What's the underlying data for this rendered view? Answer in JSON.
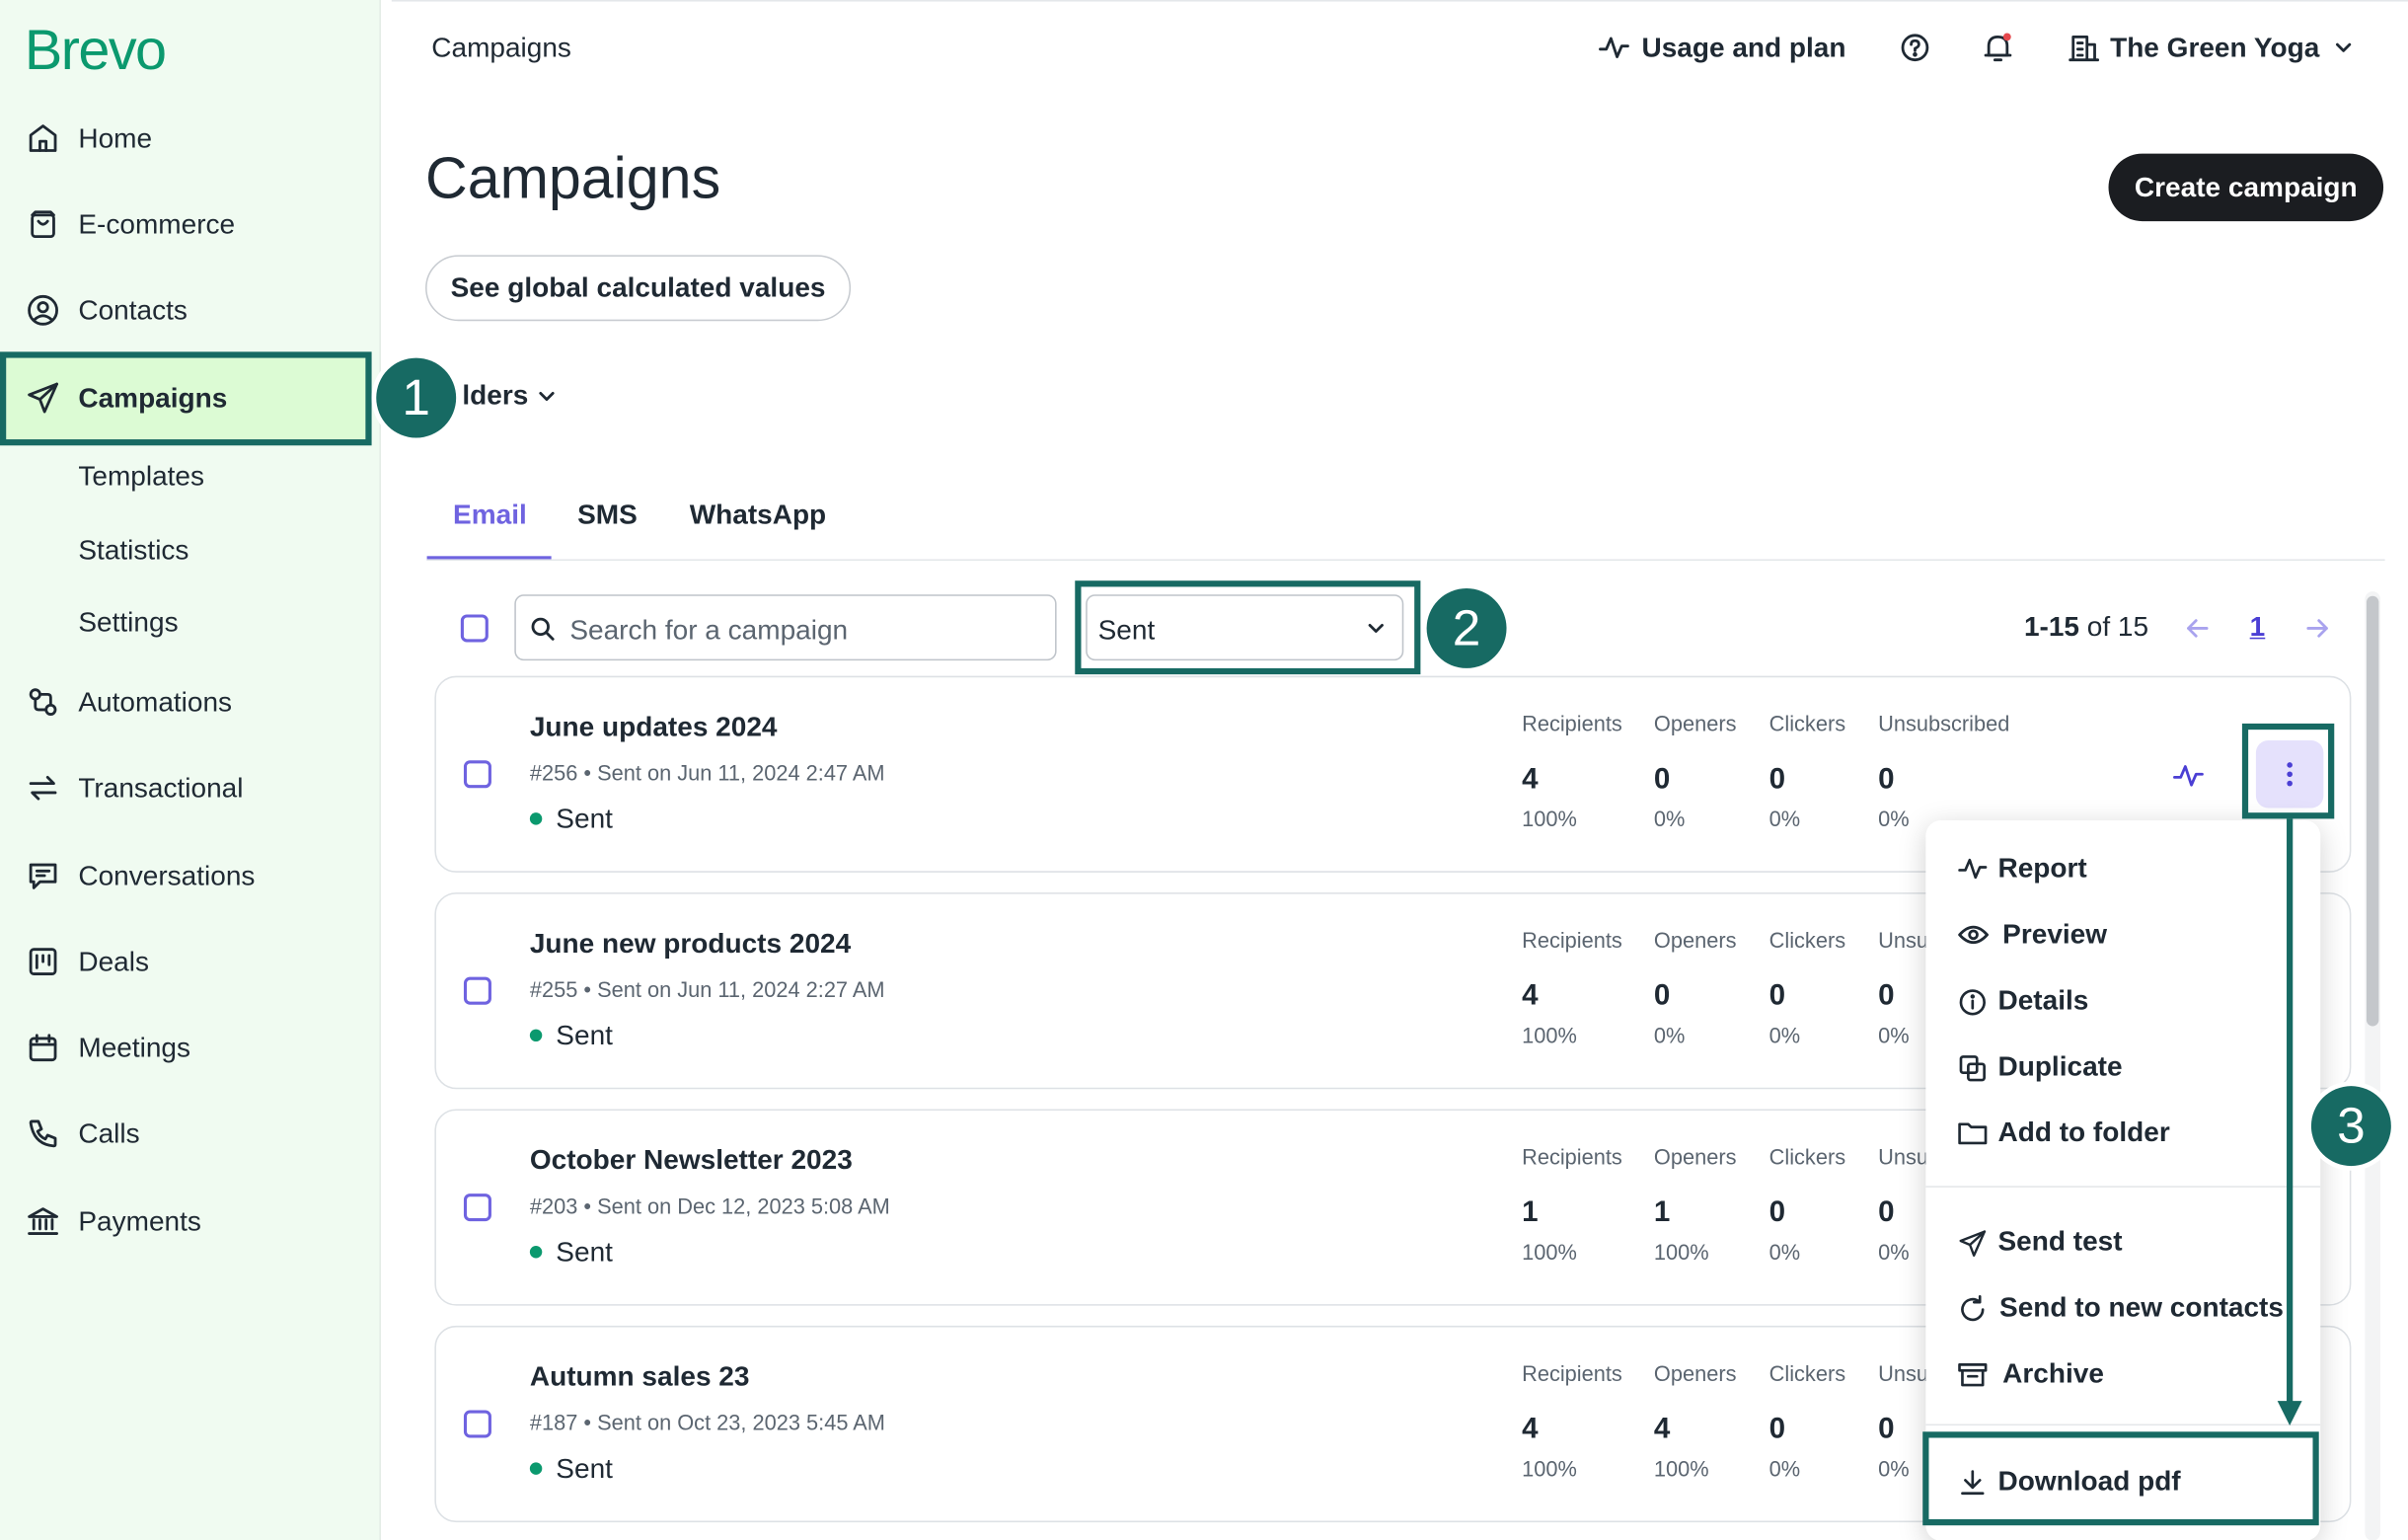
{
  "app": {
    "logo": "Brevo"
  },
  "sidebar": {
    "items": [
      {
        "label": "Home",
        "icon": "home-icon"
      },
      {
        "label": "E-commerce",
        "icon": "shopping-bag-icon"
      },
      {
        "label": "Contacts",
        "icon": "user-circle-icon"
      },
      {
        "label": "Campaigns",
        "icon": "send-icon"
      },
      {
        "label": "Automations",
        "icon": "automation-icon"
      },
      {
        "label": "Transactional",
        "icon": "arrows-swap-icon"
      },
      {
        "label": "Conversations",
        "icon": "chat-icon"
      },
      {
        "label": "Deals",
        "icon": "kanban-icon"
      },
      {
        "label": "Meetings",
        "icon": "calendar-icon"
      },
      {
        "label": "Calls",
        "icon": "phone-icon"
      },
      {
        "label": "Payments",
        "icon": "bank-icon"
      }
    ],
    "subitems": [
      "Templates",
      "Statistics",
      "Settings"
    ]
  },
  "topbar": {
    "title": "Campaigns",
    "usage": "Usage and plan",
    "account": "The Green Yoga"
  },
  "page": {
    "title": "Campaigns",
    "create_button": "Create campaign",
    "global_button": "See global calculated values",
    "folders": "lders"
  },
  "tabs": [
    "Email",
    "SMS",
    "WhatsApp"
  ],
  "filters": {
    "search_placeholder": "Search for a campaign",
    "status": "Sent",
    "range": "1-15",
    "total": "of 15",
    "page": "1"
  },
  "stat_labels": {
    "recipients": "Recipients",
    "openers": "Openers",
    "clickers": "Clickers",
    "unsubscribed": "Unsubscribed",
    "unsub_short": "Unsu"
  },
  "campaigns": [
    {
      "name": "June updates 2024",
      "id": "#256",
      "sent_on": "Sent on Jun 11, 2024 2:47 AM",
      "status": "Sent",
      "recipients": "4",
      "recipients_pct": "100%",
      "openers": "0",
      "openers_pct": "0%",
      "clickers": "0",
      "clickers_pct": "0%",
      "unsub": "0",
      "unsub_pct": "0%"
    },
    {
      "name": "June new products 2024",
      "id": "#255",
      "sent_on": "Sent on Jun 11, 2024 2:27 AM",
      "status": "Sent",
      "recipients": "4",
      "recipients_pct": "100%",
      "openers": "0",
      "openers_pct": "0%",
      "clickers": "0",
      "clickers_pct": "0%",
      "unsub": "0",
      "unsub_pct": "0%"
    },
    {
      "name": "October Newsletter 2023",
      "id": "#203",
      "sent_on": "Sent on Dec 12, 2023 5:08 AM",
      "status": "Sent",
      "recipients": "1",
      "recipients_pct": "100%",
      "openers": "1",
      "openers_pct": "100%",
      "clickers": "0",
      "clickers_pct": "0%",
      "unsub": "0",
      "unsub_pct": "0%"
    },
    {
      "name": "Autumn sales 23",
      "id": "#187",
      "sent_on": "Sent on Oct 23, 2023 5:45 AM",
      "status": "Sent",
      "recipients": "4",
      "recipients_pct": "100%",
      "openers": "4",
      "openers_pct": "100%",
      "clickers": "0",
      "clickers_pct": "0%",
      "unsub": "0",
      "unsub_pct": "0%"
    }
  ],
  "menu": {
    "items": [
      {
        "label": "Report",
        "icon": "activity-icon"
      },
      {
        "label": "Preview",
        "icon": "eye-icon"
      },
      {
        "label": "Details",
        "icon": "info-icon"
      },
      {
        "label": "Duplicate",
        "icon": "duplicate-icon"
      },
      {
        "label": "Add to folder",
        "icon": "folder-icon"
      },
      {
        "label": "Send test",
        "icon": "send-icon"
      },
      {
        "label": "Send to new contacts",
        "icon": "refresh-icon"
      },
      {
        "label": "Archive",
        "icon": "archive-icon"
      },
      {
        "label": "Download pdf",
        "icon": "download-icon"
      }
    ]
  },
  "annotations": [
    "1",
    "2",
    "3"
  ],
  "colors": {
    "brand": "#0b996e",
    "highlight": "#176a63",
    "accent": "#6f63e0",
    "active_bg": "#dcfbd4"
  }
}
